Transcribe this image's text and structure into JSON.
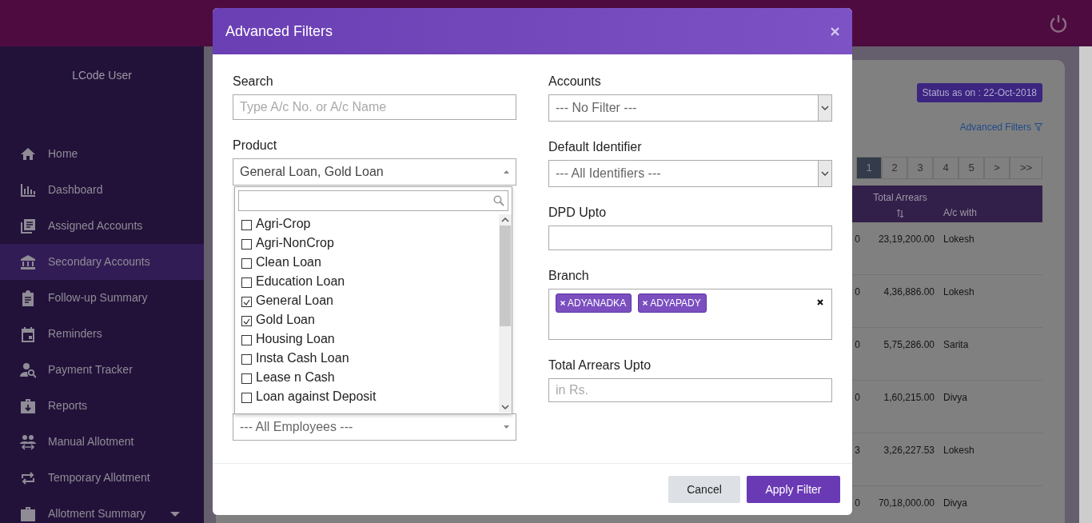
{
  "app": {
    "user": "LCode User"
  },
  "sidebar": {
    "items": [
      {
        "label": "Home",
        "selected": false,
        "has_submenu": false
      },
      {
        "label": "Dashboard",
        "selected": false,
        "has_submenu": false
      },
      {
        "label": "Assigned Accounts",
        "selected": false,
        "has_submenu": false
      },
      {
        "label": "Secondary Accounts",
        "selected": true,
        "has_submenu": false
      },
      {
        "label": "Follow-up Summary",
        "selected": false,
        "has_submenu": false
      },
      {
        "label": "Reminders",
        "selected": false,
        "has_submenu": false
      },
      {
        "label": "Payment Tracker",
        "selected": false,
        "has_submenu": false
      },
      {
        "label": "Reports",
        "selected": false,
        "has_submenu": false
      },
      {
        "label": "Manual Allotment",
        "selected": false,
        "has_submenu": false
      },
      {
        "label": "Temporary Allotment",
        "selected": false,
        "has_submenu": false
      },
      {
        "label": "Allotment Summary",
        "selected": false,
        "has_submenu": true
      }
    ]
  },
  "content": {
    "status": "Status as on : 22-Oct-2018",
    "advanced_filters_link": "Advanced Filters",
    "pagination": [
      {
        "label": "1",
        "selected": true
      },
      {
        "label": "2",
        "selected": false
      },
      {
        "label": "3",
        "selected": false
      },
      {
        "label": "4",
        "selected": false
      },
      {
        "label": "5",
        "selected": false
      },
      {
        "label": ">",
        "selected": false
      },
      {
        "label": ">>",
        "selected": false
      }
    ],
    "table": {
      "columns": [
        "Total Arrears",
        "A/c with"
      ],
      "rows": [
        {
          "column_1": "0",
          "total_arrears": "23,19,200.00",
          "ac_with": "Lokesh"
        },
        {
          "column_1": "0",
          "total_arrears": "4,36,886.00",
          "ac_with": "Lokesh"
        },
        {
          "column_1": "0",
          "total_arrears": "5,75,286.00",
          "ac_with": "Sarita"
        },
        {
          "column_1": "0",
          "total_arrears": "1,60,215.00",
          "ac_with": "Divya"
        },
        {
          "column_1": "3",
          "total_arrears": "3,26,227.53",
          "ac_with": "Lokesh"
        },
        {
          "column_1": "0",
          "total_arrears": "70,18,000.00",
          "ac_with": "Divya"
        }
      ]
    }
  },
  "modal": {
    "title": "Advanced Filters",
    "search": {
      "label": "Search",
      "placeholder": "Type A/c No. or A/c Name"
    },
    "product": {
      "label": "Product",
      "value": "General Loan, Gold Loan",
      "expanded": true,
      "options": [
        {
          "label": "Agri-Crop",
          "checked": false
        },
        {
          "label": "Agri-NonCrop",
          "checked": false
        },
        {
          "label": "Clean Loan",
          "checked": false
        },
        {
          "label": "Education Loan",
          "checked": false
        },
        {
          "label": "General Loan",
          "checked": true
        },
        {
          "label": "Gold Loan",
          "checked": true
        },
        {
          "label": "Housing Loan",
          "checked": false
        },
        {
          "label": "Insta Cash Loan",
          "checked": false
        },
        {
          "label": "Lease n Cash",
          "checked": false
        },
        {
          "label": "Loan against Deposit",
          "checked": false
        }
      ]
    },
    "employees": {
      "value": "--- All Employees ---"
    },
    "accounts": {
      "label": "Accounts",
      "value": "--- No Filter ---"
    },
    "default_identifier": {
      "label": "Default Identifier",
      "value": "--- All Identifiers ---"
    },
    "dpd_upto": {
      "label": "DPD Upto"
    },
    "branch": {
      "label": "Branch",
      "tags": [
        "ADYANADKA",
        "ADYAPADY"
      ]
    },
    "total_arrears_upto": {
      "label": "Total Arrears Upto",
      "placeholder": "in Rs."
    },
    "buttons": [
      {
        "label": "Cancel",
        "kind": "secondary"
      },
      {
        "label": "Apply Filter",
        "kind": "primary"
      }
    ]
  }
}
